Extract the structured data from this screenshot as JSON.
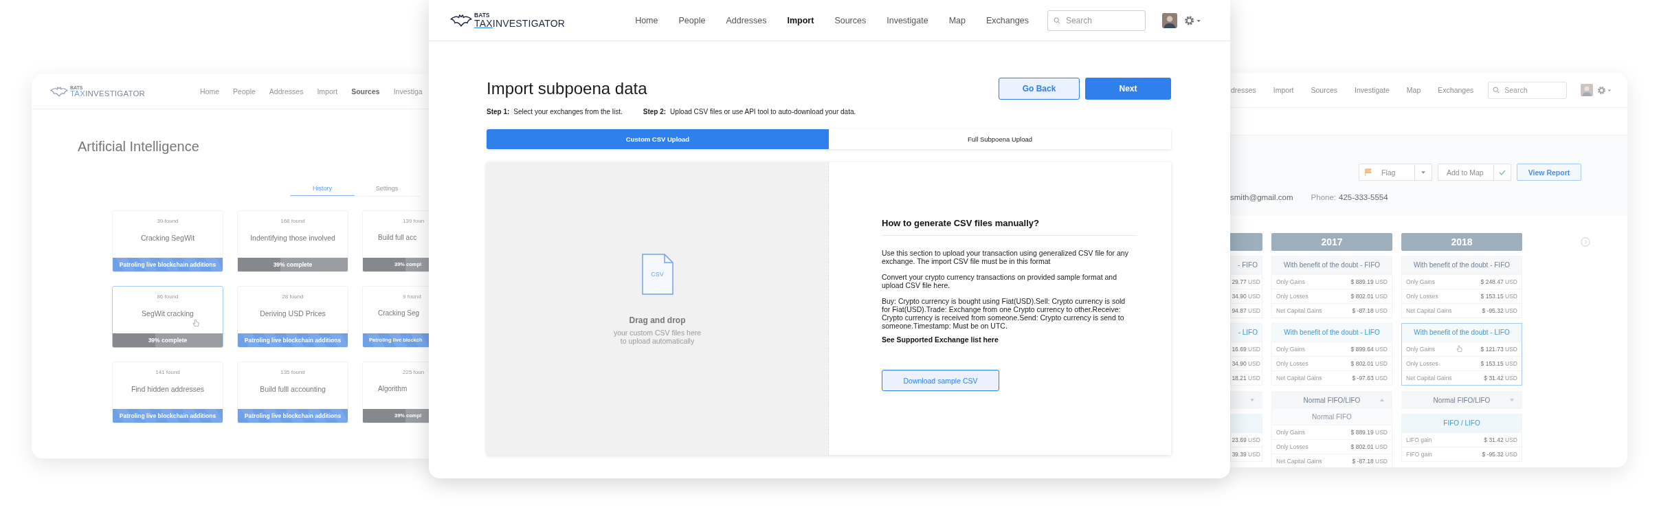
{
  "left_window": {
    "logo": {
      "top": "BATS",
      "accent": "TAX",
      "rest": "INVESTIGATOR"
    },
    "nav": [
      {
        "label": "Home",
        "selected": false
      },
      {
        "label": "People",
        "selected": false
      },
      {
        "label": "Addresses",
        "selected": false
      },
      {
        "label": "Import",
        "selected": false
      },
      {
        "label": "Sources",
        "selected": true
      },
      {
        "label": "Investiga",
        "selected": false
      }
    ],
    "title": "Artificial Intelligence",
    "tabs": [
      {
        "label": "History",
        "selected": true
      },
      {
        "label": "Settings",
        "selected": false
      }
    ],
    "cards": [
      {
        "count": "39 found",
        "title": "Cracking SegWit",
        "selected": false,
        "status": {
          "kind": "patrol",
          "text": "Patroling live blockchain additions"
        }
      },
      {
        "count": "168 found",
        "title": "Indentifying those involved",
        "selected": false,
        "status": {
          "kind": "progress",
          "text": "39% complete",
          "level": 0.39
        }
      },
      {
        "count": "139 foun",
        "title": "Build full acc",
        "selected": false,
        "status": {
          "kind": "progress",
          "text": "39% compl",
          "level": 0.39
        }
      },
      {
        "count": "86 found",
        "title": "SegWit cracking",
        "selected": true,
        "status": {
          "kind": "progress",
          "text": "39% complete",
          "level": 0.39
        }
      },
      {
        "count": "28 found",
        "title": "Deriving USD Prices",
        "selected": false,
        "status": {
          "kind": "patrol",
          "text": "Patroling live blockchain additions"
        }
      },
      {
        "count": "9 found",
        "title": "Cracking Seg",
        "selected": false,
        "status": {
          "kind": "patrol",
          "text": "Patroling live blockch"
        }
      },
      {
        "count": "141 found",
        "title": "Find hidden addresses",
        "selected": false,
        "status": {
          "kind": "patrol",
          "text": "Patroling live blockchain additions"
        }
      },
      {
        "count": "135 found",
        "title": "Build fulll accounting",
        "selected": false,
        "status": {
          "kind": "patrol",
          "text": "Patroling live blockchain additions"
        }
      },
      {
        "count": "225 foun",
        "title": "Algorithm",
        "selected": false,
        "status": {
          "kind": "progress",
          "text": "39% compl",
          "level": 0.39
        }
      }
    ]
  },
  "main_window": {
    "logo": {
      "top": "BATS",
      "accent": "TAX",
      "rest": "INVESTIGATOR"
    },
    "nav": [
      {
        "label": "Home",
        "selected": false
      },
      {
        "label": "People",
        "selected": false
      },
      {
        "label": "Addresses",
        "selected": false
      },
      {
        "label": "Import",
        "selected": true
      },
      {
        "label": "Sources",
        "selected": false
      },
      {
        "label": "Investigate",
        "selected": false
      },
      {
        "label": "Map",
        "selected": false
      },
      {
        "label": "Exchanges",
        "selected": false
      }
    ],
    "search": {
      "placeholder": "Search"
    },
    "title": "Import subpoena data",
    "buttons": [
      {
        "label": "Go Back",
        "kind": "secondary"
      },
      {
        "label": "Next",
        "kind": "primary"
      }
    ],
    "steps": [
      {
        "label": "Step 1:",
        "text": "Select your exchanges from the list."
      },
      {
        "label": "Step 2:",
        "text": "Upload CSV files or use API tool to auto-download your data."
      }
    ],
    "tabs": [
      {
        "label": "Custom CSV Upload",
        "selected": true
      },
      {
        "label": "Full Subpoena Upload",
        "selected": false
      }
    ],
    "dropzone": {
      "file_badge": "CSV",
      "title": "Drag and drop",
      "hint": "your custom CSV files here\nto upload automatically"
    },
    "help": {
      "title": "How to generate CSV files manually?",
      "paragraphs": [
        "Use this section to upload your transaction using generalized CSV file for any exchange. The import CSV file must be in this format",
        "Convert your crypto currency transactions on provided sample format and upload CSV file here.",
        "Buy: Crypto currency is bought using Fiat(USD).Sell: Crypto currency is sold for Fiat(USD).Trade: Exchange from one Crypto currency to other.Receive: Crypto currency is received from someone.Send: Crypto currency is send to someone.Timestamp: Must be on UTC."
      ],
      "link": "See Supported Exchange list here",
      "download": "Download sample CSV"
    }
  },
  "right_window": {
    "nav": [
      {
        "label": "dresses",
        "selected": false
      },
      {
        "label": "Import",
        "selected": false
      },
      {
        "label": "Sources",
        "selected": false
      },
      {
        "label": "Investigate",
        "selected": false
      },
      {
        "label": "Map",
        "selected": false
      },
      {
        "label": "Exchanges",
        "selected": false
      }
    ],
    "search": {
      "placeholder": "Search"
    },
    "actions": [
      {
        "kind": "flag",
        "label": "Flag"
      },
      {
        "kind": "confirm",
        "label": "Add to Map"
      },
      {
        "kind": "primary",
        "label": "View Report"
      }
    ],
    "contact": {
      "email": "smith@gmail.com",
      "phone_label": "Phone:",
      "phone": "425-333-5554"
    },
    "years": [
      {
        "sections": [
          {
            "kind": "plain",
            "title": "- FIFO",
            "selected": false,
            "rows": [
              {
                "value": "29.77",
                "unit": "USD"
              },
              {
                "value": "34.90",
                "unit": "USD"
              },
              {
                "value": "94.87",
                "unit": "USD"
              }
            ]
          },
          {
            "kind": "accent",
            "title": "- LIFO",
            "selected": false,
            "rows": [
              {
                "value": "16.69",
                "unit": "USD"
              },
              {
                "value": "34.90",
                "unit": "USD"
              },
              {
                "value": "18.21",
                "unit": "USD"
              }
            ]
          },
          {
            "kind": "toggle",
            "expanded": false
          },
          {
            "kind": "highlight",
            "selected": false,
            "rows": [
              {
                "value": "23.69",
                "unit": "USD"
              },
              {
                "value": "39.39",
                "unit": "USD"
              }
            ]
          }
        ]
      },
      {
        "year": "2017",
        "sections": [
          {
            "kind": "plain",
            "title": "With benefit of the doubt - FIFO",
            "selected": false,
            "rows": [
              {
                "label": "Only Gains",
                "value": "$ 889.19",
                "unit": "USD"
              },
              {
                "label": "Only Losses",
                "value": "$ 802.01",
                "unit": "USD"
              },
              {
                "label": "Net Capital Gains",
                "value": "$ -87.18",
                "unit": "USD"
              }
            ]
          },
          {
            "kind": "accent",
            "title": "With benefit of the doubt - LIFO",
            "selected": false,
            "rows": [
              {
                "label": "Only Gains",
                "value": "$ 899.64",
                "unit": "USD"
              },
              {
                "label": "Only Losses",
                "value": "$ 802.01",
                "unit": "USD"
              },
              {
                "label": "Net Capital Gains",
                "value": "$ -97.63",
                "unit": "USD"
              }
            ]
          },
          {
            "kind": "toggle",
            "title": "Normal FIFO/LIFO",
            "expanded": true
          },
          {
            "kind": "sub",
            "title": "Normal FIFO",
            "selected": false,
            "rows": [
              {
                "label": "Only Gains",
                "value": "$ 889.19",
                "unit": "USD"
              },
              {
                "label": "Only Losses",
                "value": "$ 802.01",
                "unit": "USD"
              },
              {
                "label": "Net Capital Gains",
                "value": "$ -87.18",
                "unit": "USD"
              }
            ]
          }
        ]
      },
      {
        "year": "2018",
        "sections": [
          {
            "kind": "plain",
            "title": "With benefit of the doubt - FIFO",
            "selected": false,
            "rows": [
              {
                "label": "Only Gains",
                "value": "$ 248.47",
                "unit": "USD"
              },
              {
                "label": "Only Losses",
                "value": "$ 153.15",
                "unit": "USD"
              },
              {
                "label": "Net Capital Gains",
                "value": "$ -95.32",
                "unit": "USD"
              }
            ]
          },
          {
            "kind": "accent",
            "title": "With benefit of the doubt - LIFO",
            "selected": true,
            "rows": [
              {
                "label": "Only Gains",
                "value": "$ 121.73",
                "unit": "USD"
              },
              {
                "label": "Only Losses",
                "value": "$ 153.15",
                "unit": "USD"
              },
              {
                "label": "Net Capital Gains",
                "value": "$ 31.42",
                "unit": "USD"
              }
            ]
          },
          {
            "kind": "toggle",
            "title": "Normal FIFO/LIFO",
            "expanded": false
          },
          {
            "kind": "highlight",
            "title": "FIFO / LIFO",
            "selected": false,
            "rows": [
              {
                "label": "LIFO gain",
                "value": "$ 31.42",
                "unit": "USD"
              },
              {
                "label": "FIFO gain",
                "value": "$ -95.32",
                "unit": "USD"
              }
            ]
          }
        ]
      }
    ]
  }
}
